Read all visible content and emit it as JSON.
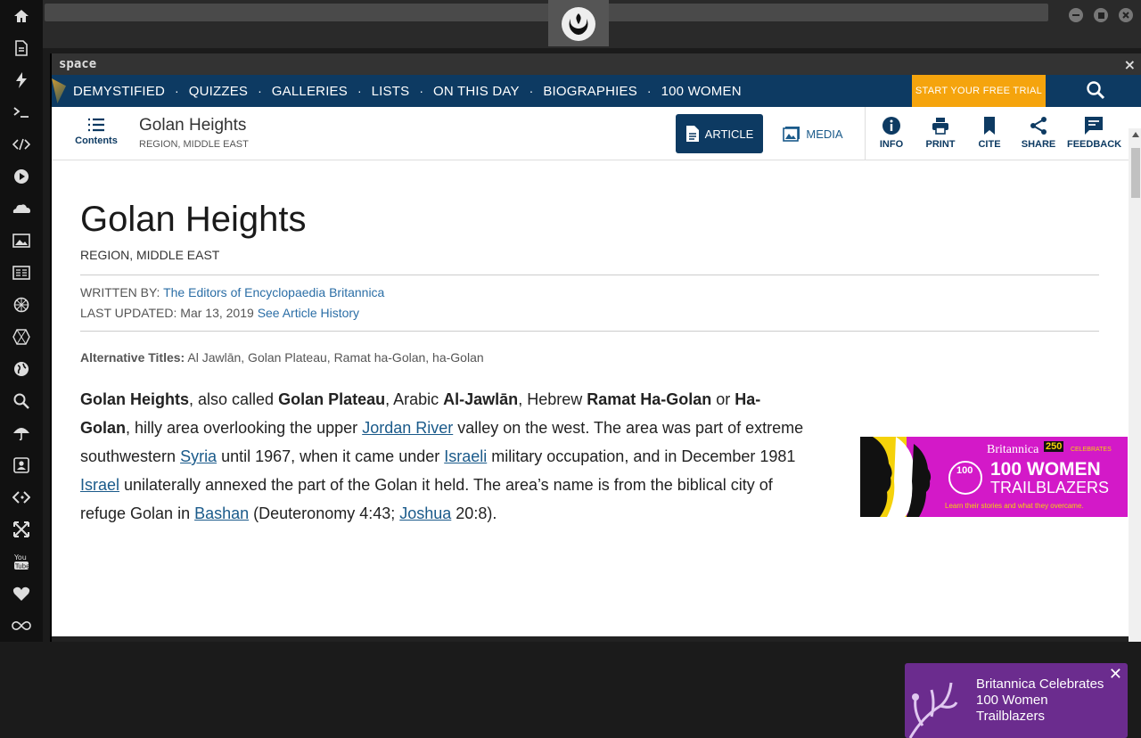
{
  "sidebar_icons": [
    "home-icon",
    "document-icon",
    "bolt-icon",
    "terminal-icon",
    "code-icon",
    "play-icon",
    "cloud-icon",
    "image-icon",
    "news-icon",
    "aperture-icon",
    "hexagon-icon",
    "globe-icon",
    "search-icon",
    "umbrella-icon",
    "contact-card-icon",
    "brackets-icon",
    "expand-icon",
    "youtube-icon",
    "heart-icon",
    "infinity-icon"
  ],
  "panel": {
    "title": "space",
    "close": "×"
  },
  "nav": {
    "items": [
      "DEMYSTIFIED",
      "QUIZZES",
      "GALLERIES",
      "LISTS",
      "ON THIS DAY",
      "BIOGRAPHIES",
      "100 WOMEN"
    ],
    "trial": "START YOUR FREE TRIAL"
  },
  "toolbar": {
    "contents": "Contents",
    "title": "Golan Heights",
    "subtitle": "REGION, MIDDLE EAST",
    "article": "ARTICLE",
    "media": "MEDIA",
    "tools": [
      "INFO",
      "PRINT",
      "CITE",
      "SHARE",
      "FEEDBACK"
    ]
  },
  "article": {
    "title": "Golan Heights",
    "subtitle": "REGION, MIDDLE EAST",
    "written_label": "WRITTEN BY:",
    "written_by": "The Editors of Encyclopaedia Britannica",
    "updated_label": "LAST UPDATED:",
    "updated_date": "Mar 13, 2019",
    "history_link": "See Article History",
    "alt_label": "Alternative Titles:",
    "alt_titles": "Al Jawlān, Golan Plateau, Ramat ha-Golan, ha-Golan",
    "p": {
      "b1": "Golan Heights",
      "t1": ", also called ",
      "b2": "Golan Plateau",
      "t2": ", Arabic ",
      "b3": "Al-Jawlān",
      "t3": ", Hebrew ",
      "b4": "Ramat Ha-Golan",
      "t4": " or ",
      "b5": "Ha-Golan",
      "t5": ", hilly area overlooking the upper ",
      "l1": "Jordan River",
      "t6": " valley on the west. The area was part of extreme southwestern ",
      "l2": "Syria",
      "t7": " until 1967, when it came under ",
      "l3": "Israeli",
      "t8": " military occupation, and in December 1981 ",
      "l4": "Israel",
      "t9": " unilaterally annexed the part of the Golan it held. The area’s name is from the biblical city of refuge Golan in ",
      "l5": "Bashan",
      "t10": " (Deuteronomy 4:43; ",
      "l6": "Joshua",
      "t11": " 20:8)."
    }
  },
  "ad": {
    "brand": "Britannica",
    "anniv": "250",
    "celebrates": "CELEBRATES",
    "badge": "100",
    "headline": "100 WOMEN",
    "sub": "TRAILBLAZERS",
    "tagline": "Learn their stories and what they overcame."
  },
  "popup": {
    "text1": "Britannica Celebrates",
    "text2": "100 Women",
    "text3": "Trailblazers",
    "close": "✕"
  },
  "colors": {
    "nav_bg": "#0d3a62",
    "trial_bg": "#f5a40d",
    "ad_bg": "#d319c8",
    "popup_bg": "#6b2c8e"
  }
}
